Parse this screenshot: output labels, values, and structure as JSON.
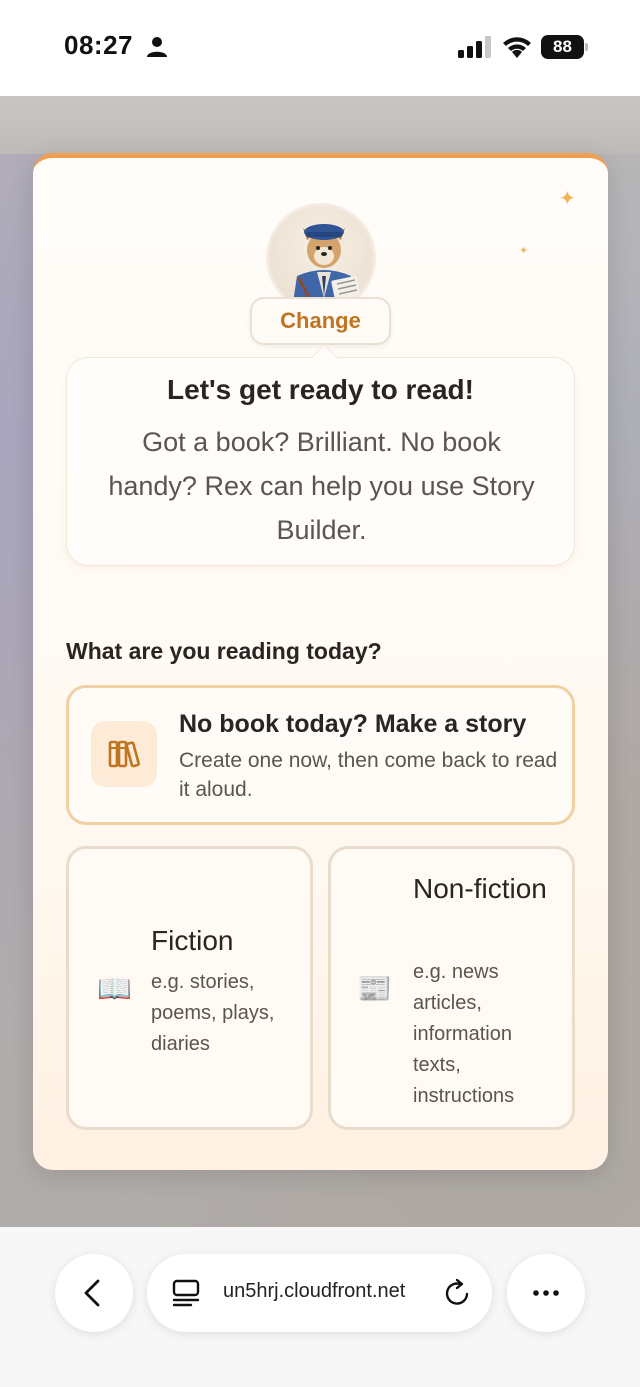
{
  "status_bar": {
    "time": "08:27",
    "battery": "88"
  },
  "rex_avatar": {
    "change_label": "Change"
  },
  "speech": {
    "title": "Let's get ready to read!",
    "body": "Got a book? Brilliant. No book handy? Rex can help you use Story Builder."
  },
  "reading": {
    "heading": "What are you reading today?",
    "story_option": {
      "title": "No book today? Make a story",
      "description": "Create one now, then come back to read it aloud.",
      "icon": "books-icon"
    },
    "fiction": {
      "title": "Fiction",
      "description": "e.g. stories, poems, plays, diaries",
      "icon": "open-book-icon"
    },
    "nonfiction": {
      "title": "Non-fiction",
      "description": "e.g. news articles, information texts, instructions",
      "icon": "newspaper-icon"
    }
  },
  "browser": {
    "url": "un5hrj.cloudfront.net"
  },
  "colors": {
    "accent": "#c0741f",
    "card_border": "#f3cfa4",
    "top_stripe": "#f0a050"
  }
}
